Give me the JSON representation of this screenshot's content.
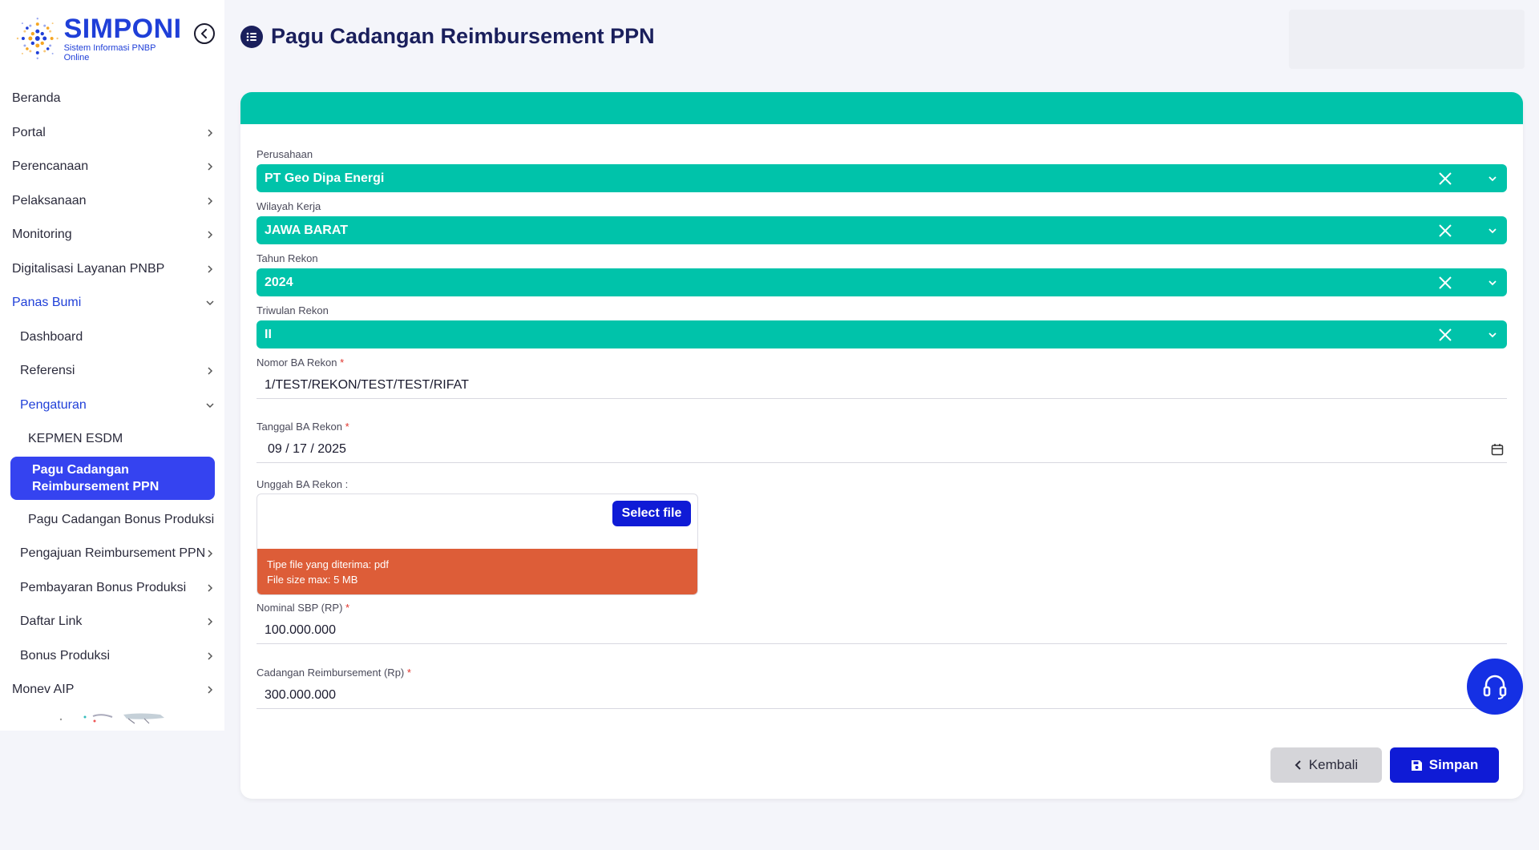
{
  "app": {
    "logo_title": "SIMPONI",
    "logo_subtitle": "Sistem Informasi PNBP Online"
  },
  "sidebar": {
    "items": [
      {
        "label": "Beranda"
      },
      {
        "label": "Portal"
      },
      {
        "label": "Perencanaan"
      },
      {
        "label": "Pelaksanaan"
      },
      {
        "label": "Monitoring"
      },
      {
        "label": "Digitalisasi Layanan PNBP"
      },
      {
        "label": "Panas Bumi"
      },
      {
        "label": "Dashboard"
      },
      {
        "label": "Referensi"
      },
      {
        "label": "Pengaturan"
      },
      {
        "label": "KEPMEN ESDM"
      },
      {
        "label": "Pagu Cadangan Reimbursement PPN"
      },
      {
        "label": "Pagu Cadangan Bonus Produksi"
      },
      {
        "label": "Pengajuan Reimbursement PPN"
      },
      {
        "label": "Pembayaran Bonus Produksi"
      },
      {
        "label": "Daftar Link"
      },
      {
        "label": "Bonus Produksi"
      },
      {
        "label": "Monev AIP"
      }
    ]
  },
  "page": {
    "title": "Pagu Cadangan Reimbursement PPN"
  },
  "form": {
    "perusahaan": {
      "label": "Perusahaan",
      "value": "PT Geo Dipa Energi"
    },
    "wilayah": {
      "label": "Wilayah Kerja",
      "value": "JAWA BARAT"
    },
    "tahun": {
      "label": "Tahun Rekon",
      "value": "2024"
    },
    "triwulan": {
      "label": "Triwulan Rekon",
      "value": "II"
    },
    "nomor_ba": {
      "label": "Nomor BA Rekon",
      "required_mark": "*",
      "value": "1/TEST/REKON/TEST/TEST/RIFAT"
    },
    "tanggal_ba": {
      "label": "Tanggal BA Rekon",
      "required_mark": "*",
      "value": "09 / 17 / 2025"
    },
    "unggah_ba": {
      "label": "Unggah BA Rekon :",
      "select_label": "Select file",
      "info_line1": "Tipe file yang diterima: pdf",
      "info_line2": "File size max: 5 MB"
    },
    "nominal_sbp": {
      "label": "Nominal SBP (RP)",
      "required_mark": "*",
      "value": "100.000.000"
    },
    "cadangan": {
      "label": "Cadangan Reimbursement (Rp)",
      "required_mark": "*",
      "value": "300.000.000"
    }
  },
  "actions": {
    "back_label": "Kembali",
    "save_label": "Simpan"
  },
  "colors": {
    "primary": "#1f3fd8",
    "teal": "#00c3aa",
    "warning": "#dd5d38",
    "save": "#0f1bd6"
  }
}
